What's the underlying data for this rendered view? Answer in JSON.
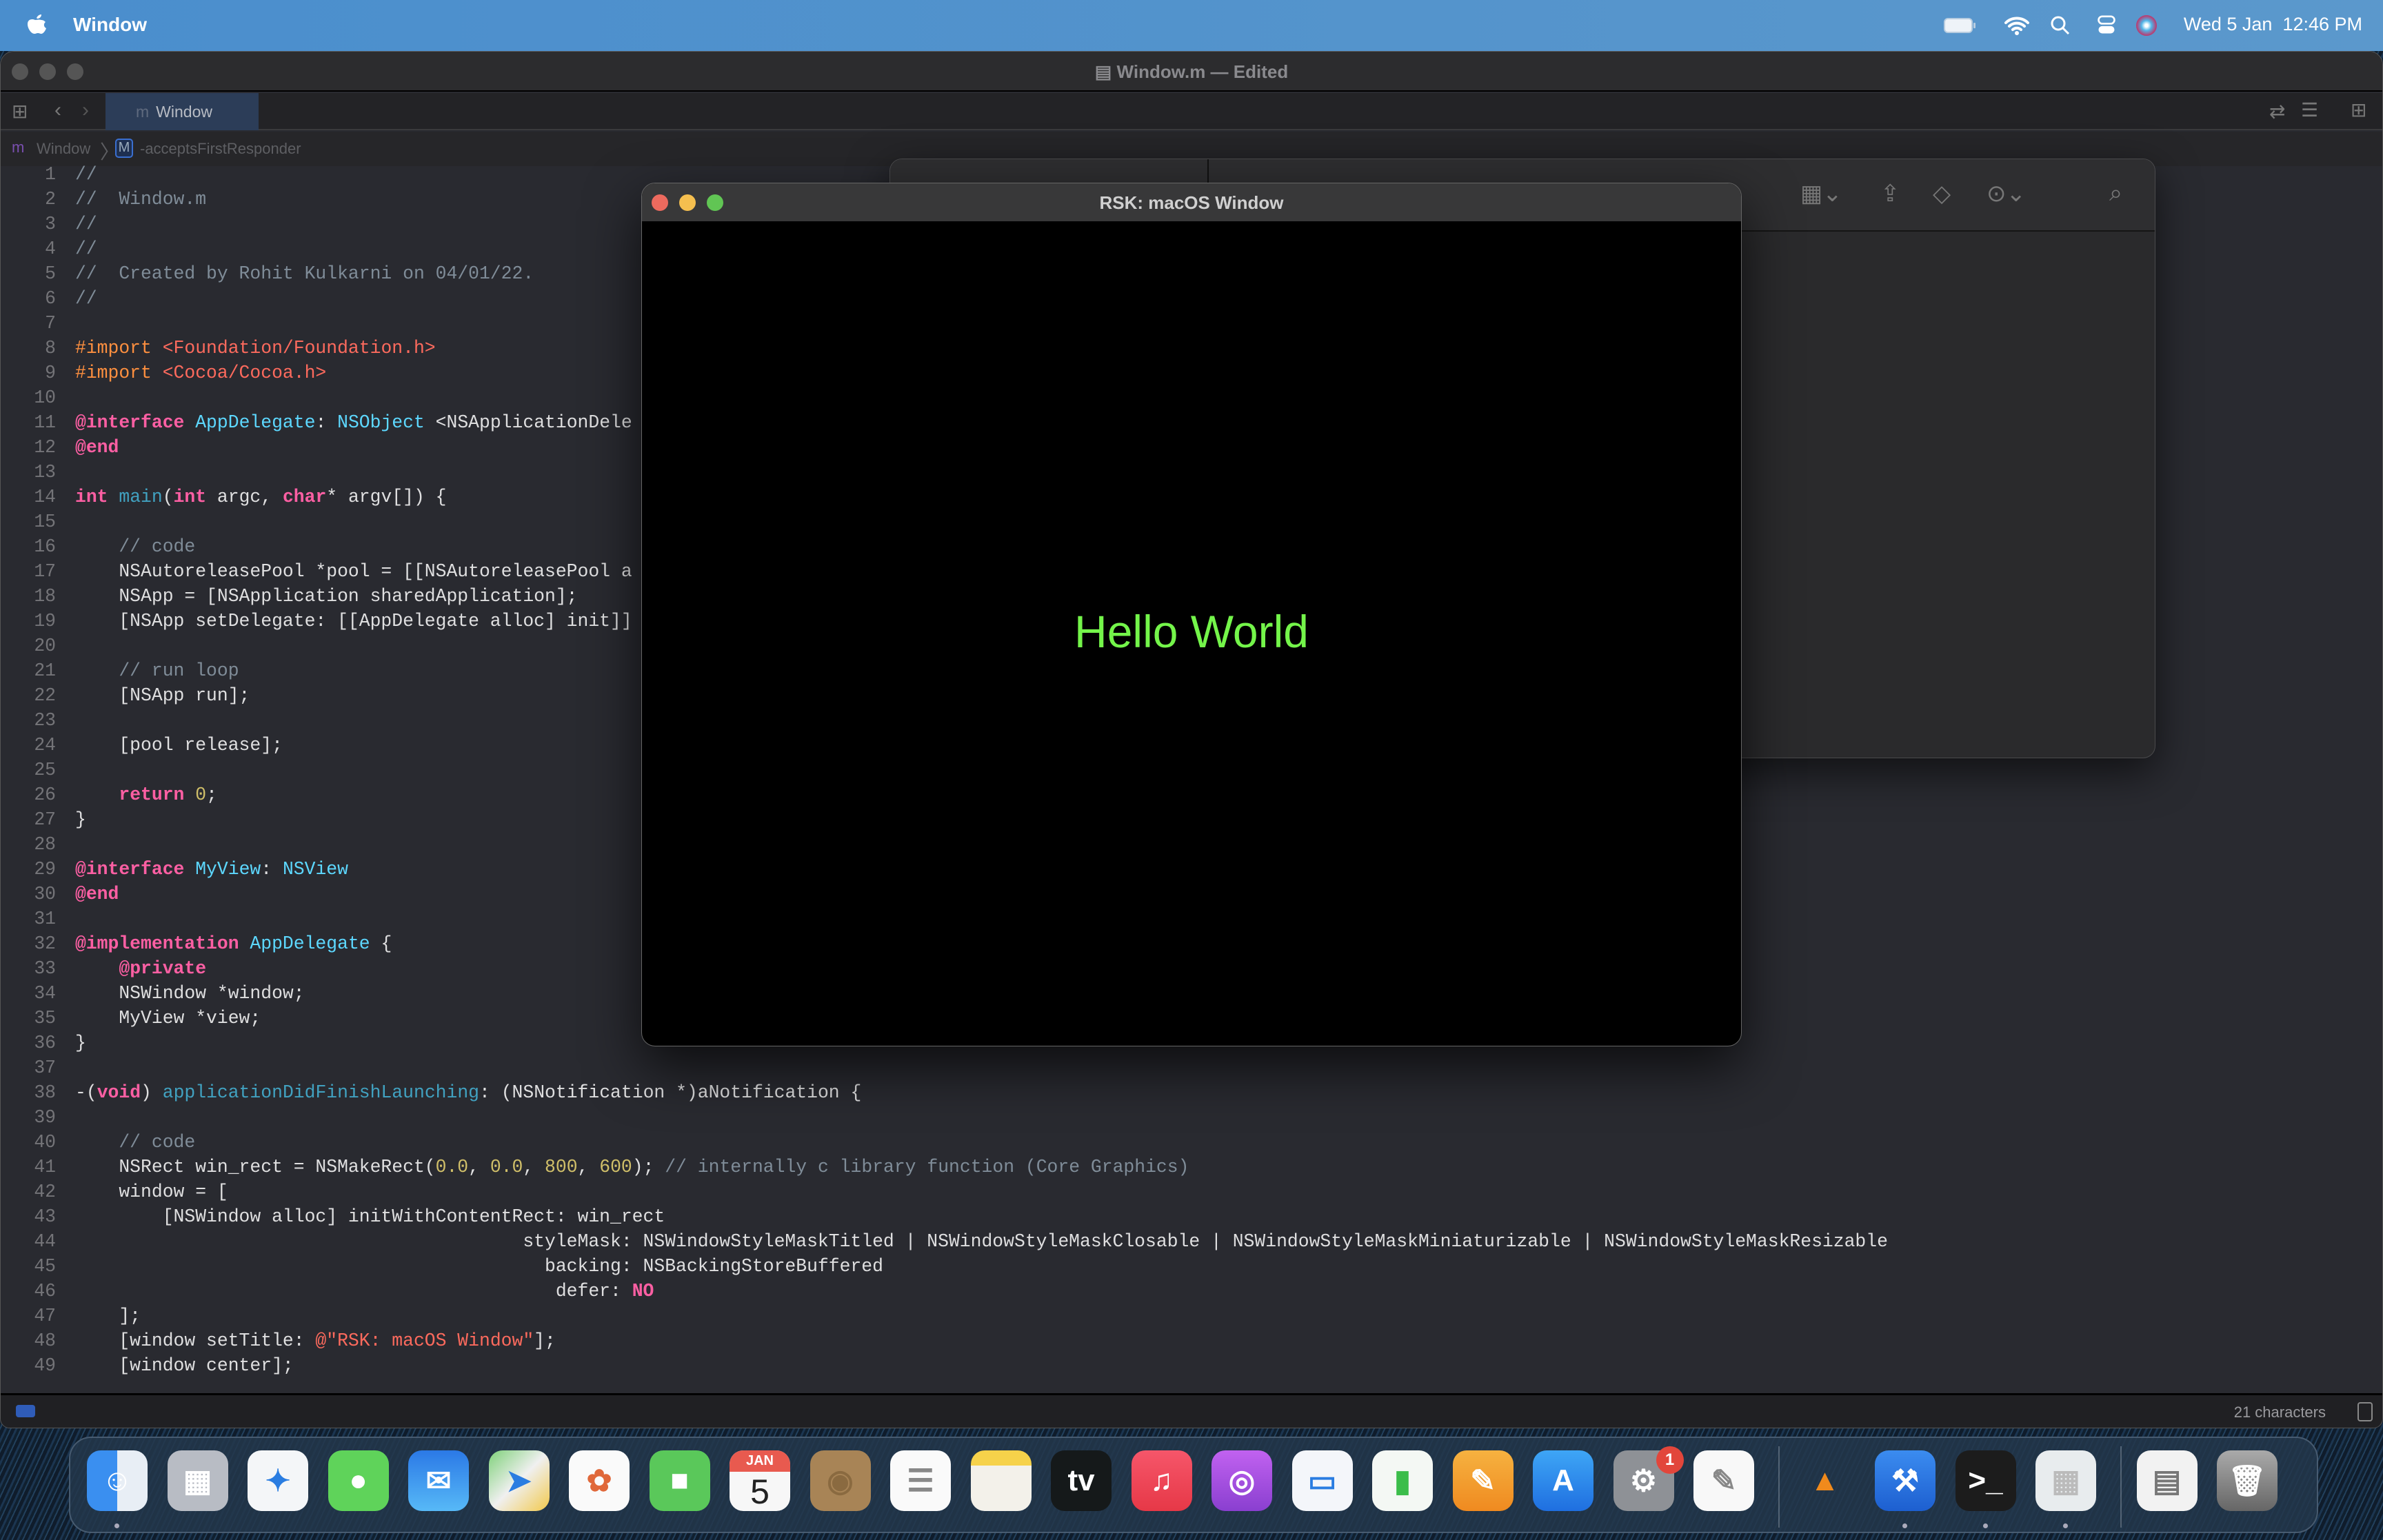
{
  "menubar": {
    "app_name": "Window",
    "clock": "Wed 5 Jan  12:46 PM",
    "icons": [
      "apple-icon",
      "battery-icon",
      "wifi-icon",
      "spotlight-icon",
      "control-center-icon",
      "siri-icon"
    ]
  },
  "xcode": {
    "title": "Window.m — Edited",
    "tab_icon": "m",
    "tab_label": "Window",
    "breadcrumb": {
      "file_icon": "m",
      "file": "Window",
      "symbol_icon": "M",
      "symbol": "-acceptsFirstResponder"
    },
    "status": {
      "char_count": "21 characters"
    },
    "code_lines": [
      [
        [
          "c",
          "//"
        ]
      ],
      [
        [
          "c",
          "//  Window.m"
        ]
      ],
      [
        [
          "c",
          "//"
        ]
      ],
      [
        [
          "c",
          "//"
        ]
      ],
      [
        [
          "c",
          "//  Created by Rohit Kulkarni on 04/01/22."
        ]
      ],
      [
        [
          "c",
          "//"
        ]
      ],
      [],
      [
        [
          "p",
          "#import"
        ],
        [
          "",
          " "
        ],
        [
          "s",
          "<Foundation/Foundation.h>"
        ]
      ],
      [
        [
          "p",
          "#import"
        ],
        [
          "",
          " "
        ],
        [
          "s",
          "<Cocoa/Cocoa.h>"
        ]
      ],
      [],
      [
        [
          "k",
          "@interface"
        ],
        [
          "",
          " "
        ],
        [
          "t",
          "AppDelegate"
        ],
        [
          "",
          ": "
        ],
        [
          "t",
          "NSObject"
        ],
        [
          "",
          " <NSApplicationDele"
        ]
      ],
      [
        [
          "k",
          "@end"
        ]
      ],
      [],
      [
        [
          "k",
          "int"
        ],
        [
          "",
          " "
        ],
        [
          "f",
          "main"
        ],
        [
          "",
          "("
        ],
        [
          "k",
          "int"
        ],
        [
          "",
          " argc, "
        ],
        [
          "k",
          "char"
        ],
        [
          "",
          "* argv[]) {"
        ]
      ],
      [],
      [
        [
          "c",
          "    // code"
        ]
      ],
      [
        [
          "",
          "    NSAutoreleasePool *pool = [[NSAutoreleasePool a"
        ]
      ],
      [
        [
          "",
          "    NSApp = [NSApplication sharedApplication];"
        ]
      ],
      [
        [
          "",
          "    [NSApp setDelegate: [[AppDelegate alloc] init]]"
        ]
      ],
      [],
      [
        [
          "c",
          "    // run loop"
        ]
      ],
      [
        [
          "",
          "    [NSApp run];"
        ]
      ],
      [],
      [
        [
          "",
          "    [pool release];"
        ]
      ],
      [],
      [
        [
          "",
          "    "
        ],
        [
          "k",
          "return"
        ],
        [
          "",
          " "
        ],
        [
          "n",
          "0"
        ],
        [
          "",
          ";"
        ]
      ],
      [
        [
          "",
          "}"
        ]
      ],
      [],
      [
        [
          "k",
          "@interface"
        ],
        [
          "",
          " "
        ],
        [
          "t",
          "MyView"
        ],
        [
          "",
          ": "
        ],
        [
          "t",
          "NSView"
        ]
      ],
      [
        [
          "k",
          "@end"
        ]
      ],
      [],
      [
        [
          "k",
          "@implementation"
        ],
        [
          "",
          " "
        ],
        [
          "t",
          "AppDelegate"
        ],
        [
          "",
          " {"
        ]
      ],
      [
        [
          "",
          "    "
        ],
        [
          "k",
          "@private"
        ]
      ],
      [
        [
          "",
          "    NSWindow *window;"
        ]
      ],
      [
        [
          "",
          "    MyView *view;"
        ]
      ],
      [
        [
          "",
          "}"
        ]
      ],
      [],
      [
        [
          "",
          "-("
        ],
        [
          "k",
          "void"
        ],
        [
          "",
          ") "
        ],
        [
          "f",
          "applicationDidFinishLaunching"
        ],
        [
          "",
          ": (NSNotification *)aNotification {"
        ]
      ],
      [],
      [
        [
          "c",
          "    // code"
        ]
      ],
      [
        [
          "",
          "    NSRect win_rect = NSMakeRect("
        ],
        [
          "n",
          "0.0"
        ],
        [
          "",
          ", "
        ],
        [
          "n",
          "0.0"
        ],
        [
          "",
          ", "
        ],
        [
          "n",
          "800"
        ],
        [
          "",
          ", "
        ],
        [
          "n",
          "600"
        ],
        [
          "",
          "); "
        ],
        [
          "c",
          "// internally c library function (Core Graphics)"
        ]
      ],
      [
        [
          "",
          "    window = ["
        ]
      ],
      [
        [
          "",
          "        [NSWindow alloc] initWithContentRect: win_rect"
        ]
      ],
      [
        [
          "",
          "                                         styleMask: NSWindowStyleMaskTitled | NSWindowStyleMaskClosable | NSWindowStyleMaskMiniaturizable | NSWindowStyleMaskResizable"
        ]
      ],
      [
        [
          "",
          "                                           backing: NSBackingStoreBuffered"
        ]
      ],
      [
        [
          "",
          "                                            defer: "
        ],
        [
          "k",
          "NO"
        ]
      ],
      [
        [
          "",
          "    ];"
        ]
      ],
      [
        [
          "",
          "    [window setTitle: "
        ],
        [
          "s",
          "@\"RSK: macOS Window\""
        ],
        [
          "",
          "];"
        ]
      ],
      [
        [
          "",
          "    [window center];"
        ]
      ]
    ]
  },
  "rsk_window": {
    "title": "RSK: macOS Window",
    "content_text": "Hello World",
    "text_color": "#74f54a"
  },
  "dock": {
    "calendar_month": "JAN",
    "calendar_day": "5",
    "settings_badge": "1",
    "apps": [
      {
        "icon": "finder-icon",
        "bg": "linear-gradient(90deg,#3a8ff0 50%,#e8eef5 50%)",
        "glyph": "☺",
        "running": true
      },
      {
        "icon": "launchpad-icon",
        "bg": "#b8bcc4",
        "glyph": "▦"
      },
      {
        "icon": "safari-icon",
        "bg": "#f4f6f8",
        "glyph": "✦",
        "fg": "#2a7de1"
      },
      {
        "icon": "messages-icon",
        "bg": "#5fd35a",
        "glyph": "●"
      },
      {
        "icon": "mail-icon",
        "bg": "linear-gradient(#2b79e6,#57b9f7)",
        "glyph": "✉"
      },
      {
        "icon": "maps-icon",
        "bg": "linear-gradient(135deg,#7fd17a,#f0f0f0,#f2c94c)",
        "glyph": "➤",
        "fg": "#2a7de1"
      },
      {
        "icon": "photos-icon",
        "bg": "#fafafa",
        "glyph": "✿",
        "fg": "#e0683a"
      },
      {
        "icon": "facetime-icon",
        "bg": "#5ac85a",
        "glyph": "■"
      },
      {
        "icon": "calendar-icon",
        "bg": "#f7f7f7",
        "calendar": true
      },
      {
        "icon": "contacts-icon",
        "bg": "#a88456",
        "glyph": "◉",
        "fg": "#8a6a40"
      },
      {
        "icon": "reminders-icon",
        "bg": "#fafafa",
        "glyph": "☰",
        "fg": "#888"
      },
      {
        "icon": "notes-icon",
        "bg": "linear-gradient(#f6d24a 25%,#f3f1ea 25%)",
        "glyph": ""
      },
      {
        "icon": "apple-tv-icon",
        "bg": "#15191a",
        "glyph": "tv"
      },
      {
        "icon": "music-icon",
        "bg": "linear-gradient(#f6566a,#e63847)",
        "glyph": "♫"
      },
      {
        "icon": "podcasts-icon",
        "bg": "linear-gradient(#c162f0,#8a3fd0)",
        "glyph": "◎"
      },
      {
        "icon": "keynote-icon",
        "bg": "#f4f6fa",
        "glyph": "▭",
        "fg": "#2a7de1"
      },
      {
        "icon": "numbers-icon",
        "bg": "#f4f8f4",
        "glyph": "▮",
        "fg": "#3bbd4a"
      },
      {
        "icon": "pages-icon",
        "bg": "linear-gradient(#f6b240,#ef8a20)",
        "glyph": "✎"
      },
      {
        "icon": "app-store-icon",
        "bg": "linear-gradient(#3ea6f6,#1f6fe0)",
        "glyph": "A"
      },
      {
        "icon": "system-preferences-icon",
        "bg": "#8e9196",
        "glyph": "⚙",
        "badge": true
      },
      {
        "icon": "textedit-icon",
        "bg": "#f8f8f8",
        "glyph": "✎",
        "fg": "#888"
      },
      {
        "sep": true
      },
      {
        "icon": "vlc-icon",
        "bg": "transparent",
        "glyph": "▲",
        "fg": "#f08a1c"
      },
      {
        "icon": "xcode-icon",
        "bg": "linear-gradient(#3b8cf0,#1d5fd0)",
        "glyph": "⚒",
        "running": true
      },
      {
        "icon": "terminal-icon",
        "bg": "#1c1c1c",
        "glyph": ">_",
        "running": true
      },
      {
        "icon": "simulator-icon",
        "bg": "#e8ecee",
        "glyph": "▦",
        "fg": "#bbb",
        "running": true
      },
      {
        "sep": true
      },
      {
        "icon": "downloads-stack-icon",
        "bg": "#f2f2f2",
        "glyph": "▤",
        "fg": "#777"
      },
      {
        "icon": "trash-icon",
        "bg": "linear-gradient(#aaa,#666)",
        "glyph": "🗑"
      }
    ]
  }
}
